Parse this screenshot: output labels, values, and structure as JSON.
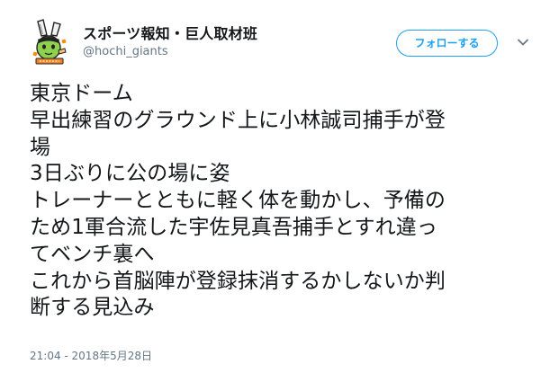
{
  "tweet": {
    "author": {
      "display_name": "スポーツ報知・巨人取材班",
      "handle": "@hochi_giants",
      "avatar_icon": "giants-mascot-avatar"
    },
    "follow_button_label": "フォローする",
    "menu_icon": "chevron-down-icon",
    "text_lines": [
      "東京ドーム",
      "早出練習のグラウンド上に小林誠司捕手が登",
      "場",
      "3日ぶりに公の場に姿",
      "トレーナーとともに軽く体を動かし、予備の",
      "ため1軍合流した宇佐見真吾捕手とすれ違っ",
      "てベンチ裏へ",
      "これから首脳陣が登録抹消するかしないか判",
      "断する見込み"
    ],
    "timestamp": "21:04 - 2018年5月28日"
  },
  "colors": {
    "accent": "#1da1f2",
    "text": "#14171a",
    "secondary_text": "#657786"
  }
}
